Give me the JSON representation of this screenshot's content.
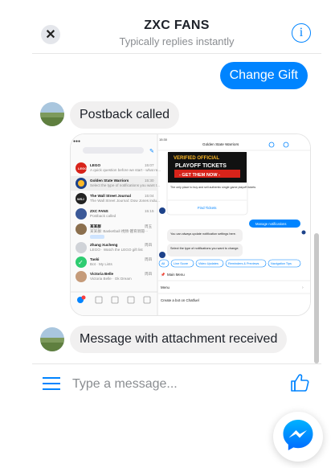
{
  "header": {
    "close_glyph": "✕",
    "title": "ZXC FANS",
    "subtitle": "Typically replies instantly",
    "info_glyph": "i"
  },
  "messages": [
    {
      "direction": "outgoing",
      "text": "Change Gift"
    },
    {
      "direction": "incoming",
      "text": "Postback called"
    },
    {
      "direction": "incoming",
      "type": "attachment",
      "content": "image-screenshot"
    },
    {
      "direction": "incoming",
      "text": "Message with attachment received"
    }
  ],
  "attachment_screenshot": {
    "status_time": "15:30",
    "contact_name": "Golden State Warriors",
    "banner_line1": "VERIFIED OFFICIAL",
    "banner_line2": "PLAYOFF TICKETS",
    "banner_line3": "- GET THEM NOW -",
    "card_caption": "The only place to buy and sell authentic single game playoff tickets",
    "card_button": "Find Tickets",
    "manage_notifications": "Manage notifications",
    "bot_text1": "You can always update notification settings here.",
    "bot_text2": "Select the type of notifications you want to change.",
    "quick_replies": [
      "All",
      "Line Score",
      "Video Updates",
      "Reminders & Previews",
      "Navigation Tips"
    ],
    "main_menu": "Main Menu",
    "menu": "Menu",
    "create_bot": "Create a bot on Chatfuel",
    "conversations": [
      {
        "name": "LEGO",
        "preview": "A quick question before we start - what re...",
        "time": "15:07"
      },
      {
        "name": "Golden State Warriors",
        "preview": "Select the type of notifications you want t...",
        "time": "15:30"
      },
      {
        "name": "The Wall Street Journal",
        "preview": "The Wall Street Journal: Dow Jones indu...",
        "time": "15:04"
      },
      {
        "name": "ZXC FANS",
        "preview": "Postback called",
        "time": "15:15"
      },
      {
        "name": "某某群",
        "preview": "某某群: Basketball 視頻·體育新聞···",
        "time": "周五"
      },
      {
        "name": "Zhang Xucheng",
        "preview": "LEGO · Watch the LEGO gift list",
        "time": "周四"
      },
      {
        "name": "Taski",
        "preview": "Bot · My Lists",
        "time": "周四"
      },
      {
        "name": "Victoria Belle",
        "preview": "Victoria Belle · Ok Dream",
        "time": "周四"
      }
    ]
  },
  "composer": {
    "placeholder": "Type a message..."
  },
  "colors": {
    "accent": "#0084ff",
    "bubble_incoming": "#f1f0f0",
    "divider": "#e6e6e6"
  },
  "icons": [
    "close-icon",
    "info-icon",
    "hamburger-menu-icon",
    "thumbs-up-icon",
    "messenger-logo-icon"
  ]
}
